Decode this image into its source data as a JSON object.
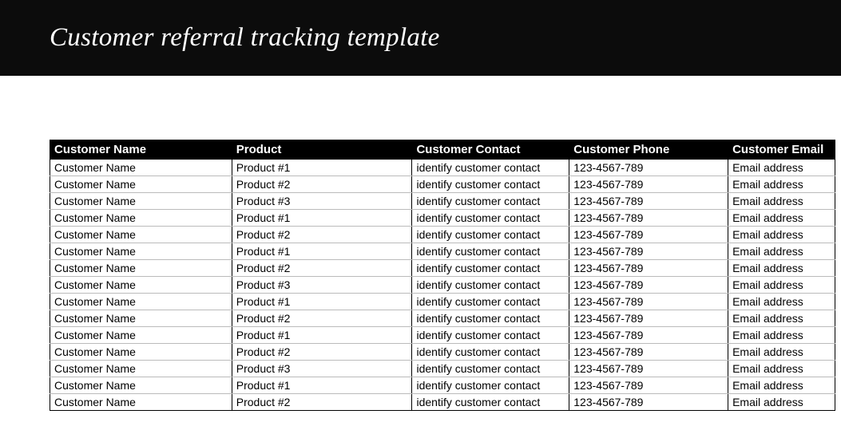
{
  "header": {
    "title": "Customer referral tracking template"
  },
  "table": {
    "columns": [
      "Customer Name",
      "Product",
      "Customer Contact",
      "Customer Phone",
      "Customer Email"
    ],
    "rows": [
      {
        "name": "Customer Name",
        "product": "Product #1",
        "contact": "identify customer contact",
        "phone": "123-4567-789",
        "email": "Email address"
      },
      {
        "name": "Customer Name",
        "product": "Product #2",
        "contact": "identify customer contact",
        "phone": "123-4567-789",
        "email": "Email address"
      },
      {
        "name": "Customer Name",
        "product": "Product #3",
        "contact": "identify customer contact",
        "phone": "123-4567-789",
        "email": "Email address"
      },
      {
        "name": "Customer Name",
        "product": "Product #1",
        "contact": "identify customer contact",
        "phone": "123-4567-789",
        "email": "Email address"
      },
      {
        "name": "Customer Name",
        "product": "Product #2",
        "contact": "identify customer contact",
        "phone": "123-4567-789",
        "email": "Email address"
      },
      {
        "name": "Customer Name",
        "product": "Product #1",
        "contact": "identify customer contact",
        "phone": "123-4567-789",
        "email": "Email address"
      },
      {
        "name": "Customer Name",
        "product": "Product #2",
        "contact": "identify customer contact",
        "phone": "123-4567-789",
        "email": "Email address"
      },
      {
        "name": "Customer Name",
        "product": "Product #3",
        "contact": "identify customer contact",
        "phone": "123-4567-789",
        "email": "Email address"
      },
      {
        "name": "Customer Name",
        "product": "Product #1",
        "contact": "identify customer contact",
        "phone": "123-4567-789",
        "email": "Email address"
      },
      {
        "name": "Customer Name",
        "product": "Product #2",
        "contact": "identify customer contact",
        "phone": "123-4567-789",
        "email": "Email address"
      },
      {
        "name": "Customer Name",
        "product": "Product #1",
        "contact": "identify customer contact",
        "phone": "123-4567-789",
        "email": "Email address"
      },
      {
        "name": "Customer Name",
        "product": "Product #2",
        "contact": "identify customer contact",
        "phone": "123-4567-789",
        "email": "Email address"
      },
      {
        "name": "Customer Name",
        "product": "Product #3",
        "contact": "identify customer contact",
        "phone": "123-4567-789",
        "email": "Email address"
      },
      {
        "name": "Customer Name",
        "product": "Product #1",
        "contact": "identify customer contact",
        "phone": "123-4567-789",
        "email": "Email address"
      },
      {
        "name": "Customer Name",
        "product": "Product #2",
        "contact": "identify customer contact",
        "phone": "123-4567-789",
        "email": "Email address"
      }
    ]
  }
}
